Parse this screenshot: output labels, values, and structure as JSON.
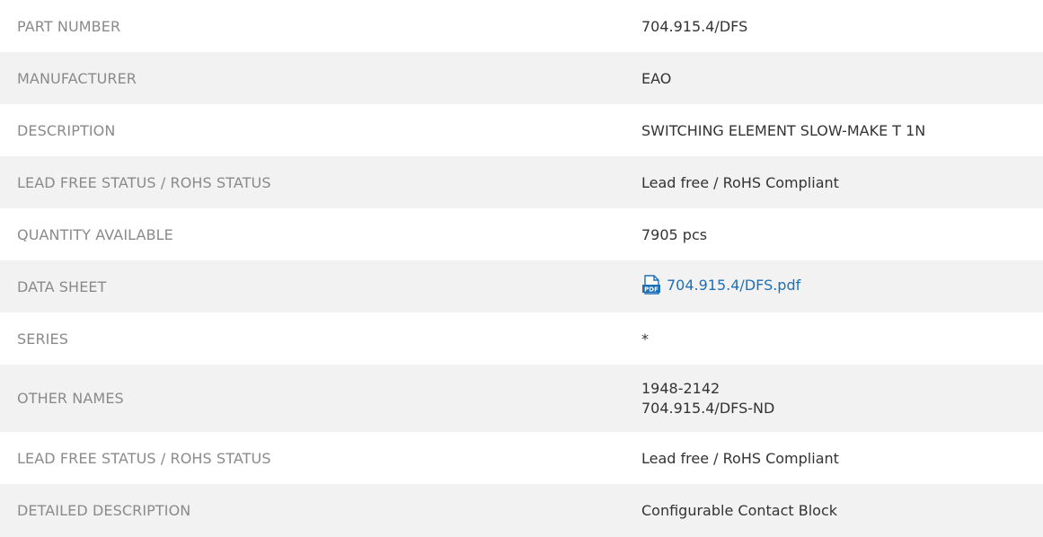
{
  "specs": [
    {
      "label": "PART NUMBER",
      "value": "704.915.4/DFS"
    },
    {
      "label": "MANUFACTURER",
      "value": "EAO"
    },
    {
      "label": "DESCRIPTION",
      "value": "SWITCHING ELEMENT SLOW-MAKE T 1N"
    },
    {
      "label": "LEAD FREE STATUS / ROHS STATUS",
      "value": "Lead free / RoHS Compliant"
    },
    {
      "label": "QUANTITY AVAILABLE",
      "value": "7905 pcs"
    },
    {
      "label": "DATA SHEET",
      "value": "704.915.4/DFS.pdf",
      "icon": "pdf-icon",
      "link_color": "#1f6fb5"
    },
    {
      "label": "SERIES",
      "value": "*"
    },
    {
      "label": "OTHER NAMES",
      "values": [
        "1948-2142",
        "704.915.4/DFS-ND"
      ]
    },
    {
      "label": "LEAD FREE STATUS / ROHS STATUS",
      "value": "Lead free / RoHS Compliant"
    },
    {
      "label": "DETAILED DESCRIPTION",
      "value": "Configurable Contact Block"
    }
  ],
  "colors": {
    "label_text": "#8a8a8a",
    "value_text": "#333333",
    "stripe_bg": "#f2f2f2",
    "link": "#1f6fb5",
    "pdf_icon": "#1f6fb5"
  }
}
